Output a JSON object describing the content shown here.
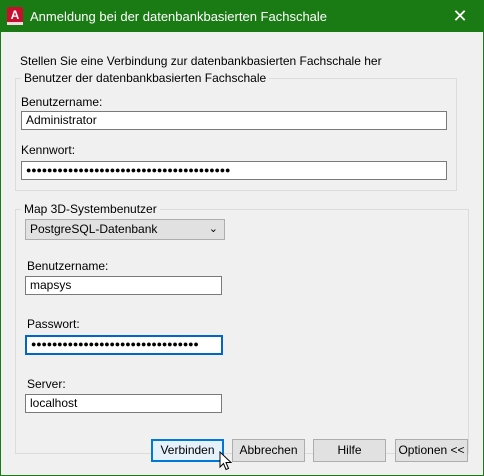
{
  "window": {
    "title": "Anmeldung bei der datenbankbasierten Fachschale",
    "app_icon_letter": "A",
    "close_symbol": "✕"
  },
  "intro": "Stellen Sie eine Verbindung zur datenbankbasierten Fachschale her",
  "fachschale_group": {
    "legend": "Benutzer der datenbankbasierten Fachschale",
    "username_label": "Benutzername:",
    "username_value": "Administrator",
    "password_label": "Kennwort:",
    "password_value": "●●●●●●●●●●●●●●●●●●●●●●●●●●●●●●●●●●●●●●●"
  },
  "system_group": {
    "legend": "Map 3D-Systembenutzer",
    "db_type": "PostgreSQL-Datenbank",
    "username_label": "Benutzername:",
    "username_value": "mapsys",
    "password_label": "Passwort:",
    "password_value": "●●●●●●●●●●●●●●●●●●●●●●●●●●●●●●●●",
    "server_label": "Server:",
    "server_value": "localhost"
  },
  "buttons": {
    "connect": "Verbinden",
    "cancel": "Abbrechen",
    "help": "Hilfe",
    "options": "Optionen <<"
  },
  "colors": {
    "titlebar": "#1a7b14",
    "focus": "#0066cc",
    "app_icon": "#c8102e"
  }
}
